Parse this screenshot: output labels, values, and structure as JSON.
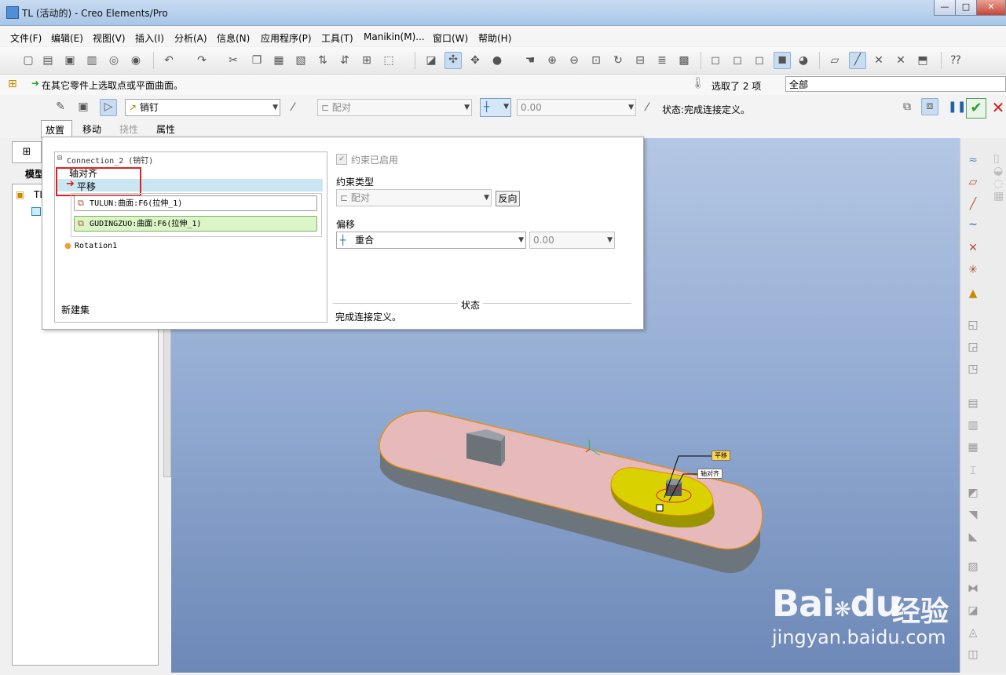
{
  "window": {
    "title": "TL (活动的) - Creo Elements/Pro",
    "minimize": "—",
    "maximize": "□",
    "close": "✕"
  },
  "menu": [
    "文件(F)",
    "编辑(E)",
    "视图(V)",
    "插入(I)",
    "分析(A)",
    "信息(N)",
    "应用程序(P)",
    "工具(T)",
    "Manikin(M)...",
    "窗口(W)",
    "帮助(H)"
  ],
  "message": {
    "text": "在其它零件上选取点或平面曲面。",
    "selection": "选取了 2 项",
    "filter": "全部"
  },
  "dashboard": {
    "connection_type": "销钉",
    "constraint_type": "配对",
    "offset_value": "0.00",
    "status": "状态:完成连接定义。",
    "tabs": [
      "放置",
      "移动",
      "挠性",
      "属性"
    ]
  },
  "left_panel": {
    "tab_label": "模型",
    "tree_root": "TL"
  },
  "placement": {
    "connection_header": "Connection_2 (销钉)",
    "constraints": [
      "轴对齐",
      "平移"
    ],
    "references": [
      "TULUN:曲面:F6(拉伸_1)",
      "GUDINGZUO:曲面:F6(拉伸_1)"
    ],
    "rotation": "Rotation1",
    "new_set": "新建集",
    "enabled_label": "约束已启用",
    "constraint_type_label": "约束类型",
    "constraint_type_value": "配对",
    "flip_label": "反向",
    "offset_label": "偏移",
    "offset_type": "重合",
    "offset_value": "0.00",
    "status_label": "状态",
    "status_text": "完成连接定义。"
  },
  "model_labels": {
    "translate": "平移",
    "axis_align": "轴对齐"
  },
  "watermark": {
    "brand": "Bai",
    "brand2": "du",
    "cn": "经验",
    "url": "jingyan.baidu.com"
  },
  "colors": {
    "highlight_red": "#e0201c",
    "accent_green": "#2f9e2f",
    "selected_row": "#c9e6f2",
    "plate": "#e6b9bb",
    "cam": "#d9d200"
  }
}
